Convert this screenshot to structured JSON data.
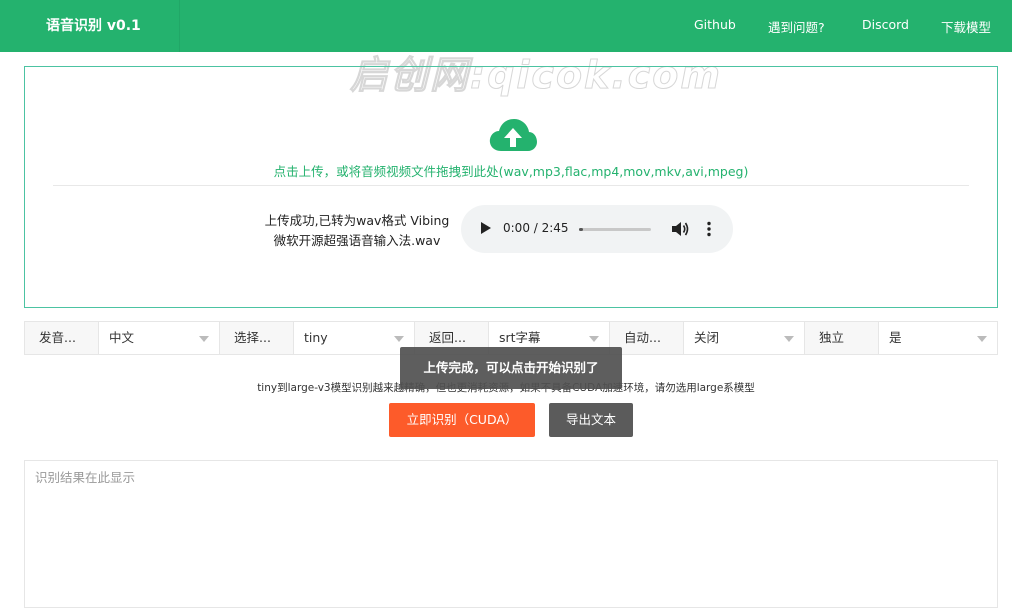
{
  "navbar": {
    "brand": "语音识别 v0.1",
    "links": [
      "Github",
      "遇到问题?",
      "Discord",
      "下载模型"
    ]
  },
  "watermark": "启创网:qicok.com",
  "upload": {
    "icon": "cloud-upload-icon",
    "hint": "点击上传，或将音频视频文件拖拽到此处(wav,mp3,flac,mp4,mov,mkv,avi,mpeg)",
    "status_line1": "上传成功,已转为wav格式 Vibing",
    "status_line2": "微软开源超强语音输入法.wav",
    "player": {
      "time": "0:00 / 2:45",
      "progress": 0.05
    }
  },
  "settings": [
    {
      "label": "发音...",
      "value": "中文"
    },
    {
      "label": "选择...",
      "value": "tiny"
    },
    {
      "label": "返回...",
      "value": "srt字幕"
    },
    {
      "label": "自动...",
      "value": "关闭"
    },
    {
      "label": "独立",
      "value": "是"
    }
  ],
  "toast": "上传完成，可以点击开始识别了",
  "model_hint": "tiny到large-v3模型识别越来越精确，但也更消耗资源，如果不具备CUDA加速环境，请勿选用large系模型",
  "buttons": {
    "start": "立即识别（CUDA）",
    "export": "导出文本"
  },
  "result": {
    "placeholder": "识别结果在此显示",
    "value": ""
  },
  "colors": {
    "primary": "#24b26e",
    "accent": "#fd5b2a",
    "dark_button": "#5b5b5b"
  }
}
